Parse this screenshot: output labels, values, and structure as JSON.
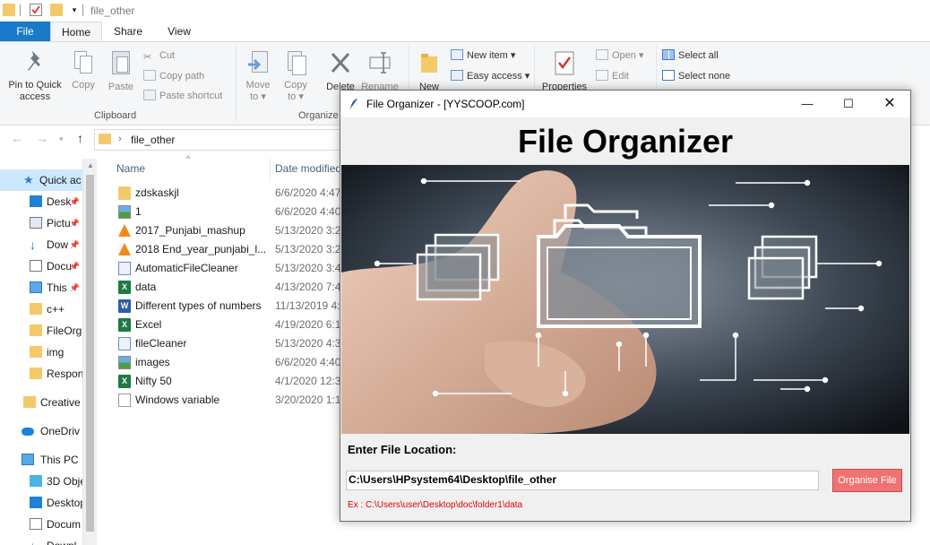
{
  "titlebar": {
    "path": "file_other"
  },
  "ribbon_tabs": [
    "File",
    "Home",
    "Share",
    "View"
  ],
  "ribbon": {
    "clipboard": {
      "pin_label_1": "Pin to Quick",
      "pin_label_2": "access",
      "copy": "Copy",
      "paste": "Paste",
      "cut": "Cut",
      "copy_path": "Copy path",
      "paste_shortcut": "Paste shortcut",
      "group": "Clipboard"
    },
    "organize": {
      "move_to_1": "Move",
      "move_to_2": "to",
      "copy_to_1": "Copy",
      "copy_to_2": "to",
      "delete": "Delete",
      "rename": "Rename",
      "group": "Organize"
    },
    "new": {
      "new_folder": "New",
      "new_item": "New item",
      "easy_access": "Easy access"
    },
    "open": {
      "properties": "Properties",
      "open": "Open",
      "edit": "Edit"
    },
    "select": {
      "select_all": "Select all",
      "select_none": "Select none"
    }
  },
  "address": {
    "path": "file_other"
  },
  "navpane": {
    "items": [
      {
        "label": "Quick ac",
        "pinned": false
      },
      {
        "label": "Desk",
        "pinned": true
      },
      {
        "label": "Pictu",
        "pinned": true
      },
      {
        "label": "Dow",
        "pinned": true
      },
      {
        "label": "Docu",
        "pinned": true
      },
      {
        "label": "This",
        "pinned": true
      },
      {
        "label": "c++",
        "pinned": false
      },
      {
        "label": "FileOrg",
        "pinned": false
      },
      {
        "label": "img",
        "pinned": false
      },
      {
        "label": "Respon",
        "pinned": false
      },
      {
        "label": "Creative",
        "pinned": false
      },
      {
        "label": "OneDriv",
        "pinned": false
      },
      {
        "label": "This PC",
        "pinned": false
      },
      {
        "label": "3D Obje",
        "pinned": false
      },
      {
        "label": "Desktop",
        "pinned": false
      },
      {
        "label": "Docum",
        "pinned": false
      },
      {
        "label": "Downl",
        "pinned": false
      }
    ]
  },
  "filelist": {
    "columns": {
      "name": "Name",
      "date": "Date modified"
    },
    "rows": [
      {
        "name": "zdskaskjl",
        "date": "6/6/2020 4:47",
        "icon": "folder-icon"
      },
      {
        "name": "1",
        "date": "6/6/2020 4:40",
        "icon": "image-file-icon"
      },
      {
        "name": "2017_Punjabi_mashup",
        "date": "5/13/2020 3:2",
        "icon": "vlc-media-icon"
      },
      {
        "name": "2018 End_year_punjabi_l...",
        "date": "5/13/2020 3:2",
        "icon": "vlc-media-icon"
      },
      {
        "name": "AutomaticFileCleaner",
        "date": "5/13/2020 3:40",
        "icon": "python-file-icon"
      },
      {
        "name": "data",
        "date": "4/13/2020 7:4",
        "icon": "excel-file-icon"
      },
      {
        "name": "Different types of numbers",
        "date": "11/13/2019 4:",
        "icon": "word-file-icon"
      },
      {
        "name": "Excel",
        "date": "4/19/2020 6:1",
        "icon": "excel-file-icon"
      },
      {
        "name": "fileCleaner",
        "date": "5/13/2020 4:3",
        "icon": "python-file-icon"
      },
      {
        "name": "images",
        "date": "6/6/2020 4:40",
        "icon": "image-file-icon"
      },
      {
        "name": "Nifty 50",
        "date": "4/1/2020 12:3",
        "icon": "excel-file-icon"
      },
      {
        "name": "Windows variable",
        "date": "3/20/2020 1:1",
        "icon": "text-file-icon"
      }
    ]
  },
  "organizer": {
    "window_title": "File Organizer - [YYSCOOP.com]",
    "heading": "File Organizer",
    "enter_label": "Enter File Location:",
    "path_value": "C:\\Users\\HPsystem64\\Desktop\\file_other",
    "button_label": "Organise File",
    "example": "Ex : C:\\Users\\user\\Desktop\\doc\\folder1\\data",
    "button_color": "#f07373",
    "example_color": "#e00000"
  },
  "colors": {
    "file_tab": "#1979ca",
    "selection": "#cce8ff",
    "folder": "#f4c96a"
  }
}
